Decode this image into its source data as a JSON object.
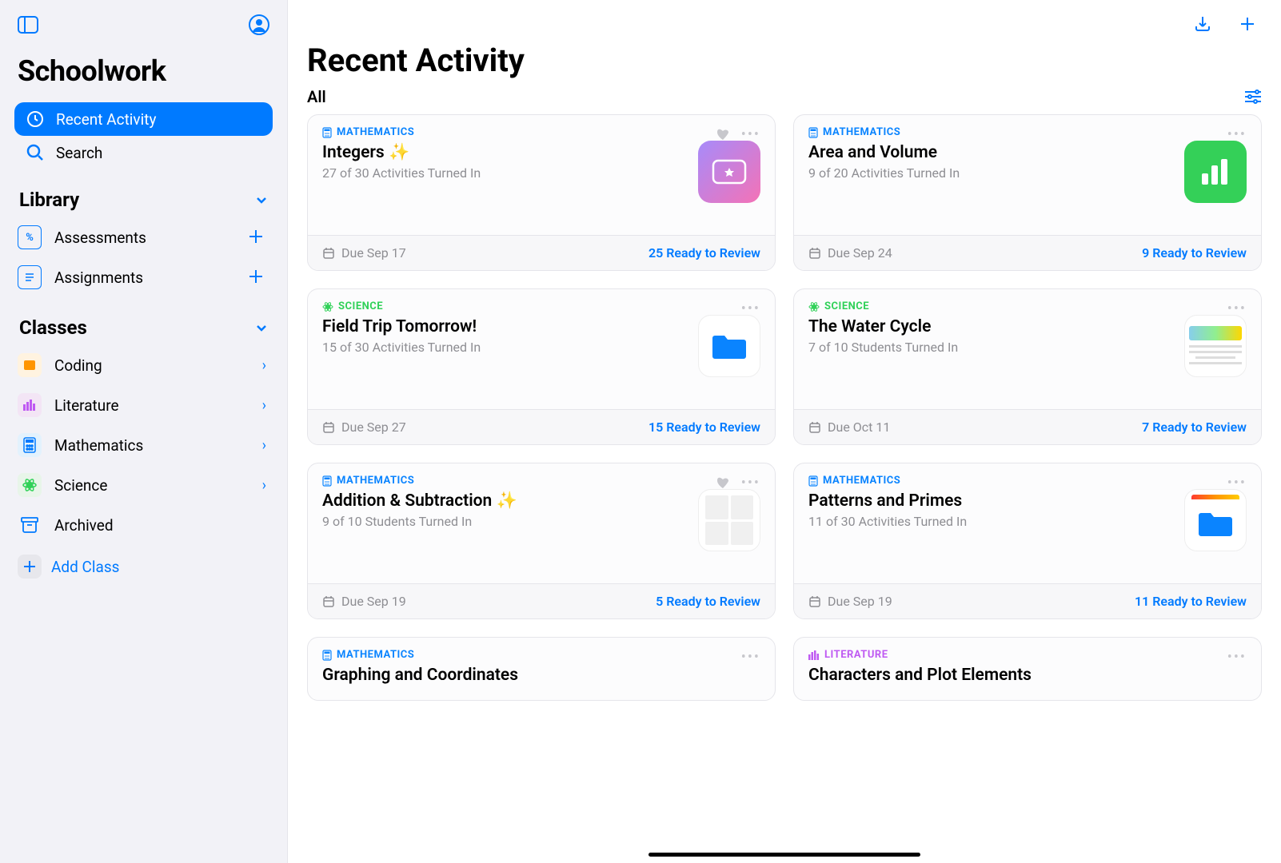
{
  "app_title": "Schoolwork",
  "sidebar": {
    "nav": [
      {
        "id": "recent",
        "label": "Recent Activity",
        "active": true
      },
      {
        "id": "search",
        "label": "Search"
      }
    ],
    "library_header": "Library",
    "library_items": [
      {
        "id": "assessments",
        "label": "Assessments"
      },
      {
        "id": "assignments",
        "label": "Assignments"
      }
    ],
    "classes_header": "Classes",
    "classes": [
      {
        "id": "coding",
        "label": "Coding"
      },
      {
        "id": "literature",
        "label": "Literature"
      },
      {
        "id": "mathematics",
        "label": "Mathematics"
      },
      {
        "id": "science",
        "label": "Science"
      },
      {
        "id": "archived",
        "label": "Archived"
      }
    ],
    "add_class_label": "Add Class"
  },
  "main": {
    "page_title": "Recent Activity",
    "filter_label": "All",
    "cards": [
      {
        "subject": "MATHEMATICS",
        "subject_class": "math",
        "title": "Integers ✨",
        "subtitle": "27 of 30 Activities Turned In",
        "has_heart": true,
        "thumb": "ticket",
        "due": "Due Sep 17",
        "review": "25 Ready to Review"
      },
      {
        "subject": "MATHEMATICS",
        "subject_class": "math",
        "title": "Area and Volume",
        "subtitle": "9 of 20 Activities Turned In",
        "has_heart": false,
        "thumb": "numbers",
        "due": "Due Sep 24",
        "review": "9 Ready to Review"
      },
      {
        "subject": "SCIENCE",
        "subject_class": "science",
        "title": "Field Trip Tomorrow!",
        "subtitle": "15 of 30 Activities Turned In",
        "has_heart": false,
        "thumb": "folder",
        "due": "Due Sep 27",
        "review": "15 Ready to Review"
      },
      {
        "subject": "SCIENCE",
        "subject_class": "science",
        "title": "The Water Cycle",
        "subtitle": "7 of 10 Students Turned In",
        "has_heart": false,
        "thumb": "doc",
        "due": "Due Oct 11",
        "review": "7 Ready to Review"
      },
      {
        "subject": "MATHEMATICS",
        "subject_class": "math",
        "title": "Addition & Subtraction ✨",
        "subtitle": "9 of 10 Students Turned In",
        "has_heart": true,
        "thumb": "worksheet",
        "due": "Due Sep 19",
        "review": "5 Ready to Review"
      },
      {
        "subject": "MATHEMATICS",
        "subject_class": "math",
        "title": "Patterns and Primes",
        "subtitle": "11 of 30 Activities Turned In",
        "has_heart": false,
        "thumb": "folder2",
        "due": "Due Sep 19",
        "review": "11 Ready to Review"
      },
      {
        "subject": "MATHEMATICS",
        "subject_class": "math",
        "title": "Graphing and Coordinates",
        "subtitle": "",
        "has_heart": false,
        "thumb": "none",
        "due": "",
        "review": ""
      },
      {
        "subject": "LITERATURE",
        "subject_class": "literature",
        "title": "Characters and Plot Elements",
        "subtitle": "",
        "has_heart": false,
        "thumb": "none",
        "due": "",
        "review": ""
      }
    ]
  }
}
